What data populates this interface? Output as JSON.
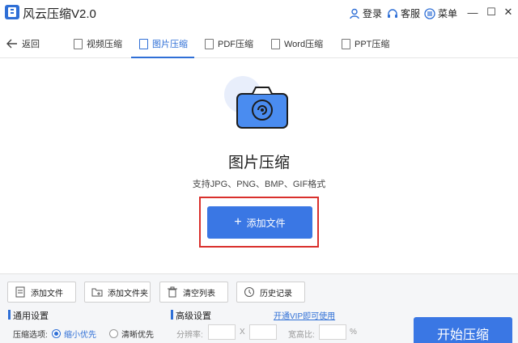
{
  "app": {
    "title": "风云压缩V2.0"
  },
  "titlebar": {
    "login_label": "登录",
    "service_label": "客服",
    "menu_label": "菜单",
    "minimize_glyph": "—",
    "maximize_glyph": "☐",
    "close_glyph": "✕"
  },
  "nav": {
    "back_label": "返回",
    "tabs": [
      {
        "label": "视频压缩",
        "icon": "video-icon"
      },
      {
        "label": "图片压缩",
        "icon": "image-icon",
        "active": true
      },
      {
        "label": "PDF压缩",
        "icon": "pdf-icon"
      },
      {
        "label": "Word压缩",
        "icon": "word-icon"
      },
      {
        "label": "PPT压缩",
        "icon": "ppt-icon"
      }
    ]
  },
  "main": {
    "title": "图片压缩",
    "subtitle": "支持JPG、PNG、BMP、GIF格式",
    "add_button_label": "添加文件",
    "add_button_icon": "+"
  },
  "toolbar": {
    "add_file_label": "添加文件",
    "add_folder_label": "添加文件夹",
    "clear_list_label": "清空列表",
    "history_label": "历史记录"
  },
  "settings": {
    "general_title": "通用设置",
    "advanced_title": "高级设置",
    "vip_link": "开通VIP即可使用",
    "compress_option_label": "压缩选项:",
    "option_small": "缩小优先",
    "option_clear": "清晰优先",
    "resolution_label": "分辨率:",
    "x_label": "X",
    "aspect_label": "宽高比:",
    "percent_label": "%"
  },
  "start_button_label": "开始压缩",
  "colors": {
    "accent": "#3a77e4",
    "highlight": "#d9302c"
  }
}
